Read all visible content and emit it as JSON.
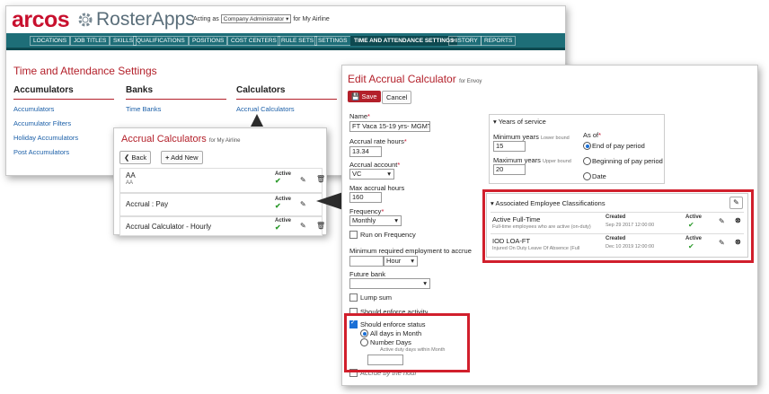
{
  "brand": {
    "logo": "arcos",
    "product": "RosterApps"
  },
  "acting": {
    "prefix": "Acting as",
    "role": "Company Administrator",
    "suffix": "for My Airline"
  },
  "nav": [
    "LOCATIONS",
    "JOB TITLES",
    "SKILLS",
    "QUALIFICATIONS",
    "POSITIONS",
    "COST CENTERS",
    "RULE SETS",
    "SETTINGS",
    "TIME AND ATTENDANCE SETTINGS",
    "HISTORY",
    "REPORTS"
  ],
  "page": {
    "title": "Time and Attendance Settings",
    "columns": {
      "accumulators": {
        "heading": "Accumulators",
        "links": [
          "Accumulators",
          "Accumulator Filters",
          "Holiday Accumulators",
          "Post Accumulators"
        ]
      },
      "banks": {
        "heading": "Banks",
        "links": [
          "Time Banks"
        ]
      },
      "calculators": {
        "heading": "Calculators",
        "links": [
          "Accrual Calculators"
        ]
      }
    }
  },
  "calcs": {
    "title": "Accrual Calculators",
    "subtitle": "for My Airline",
    "back": "Back",
    "add": "Add New",
    "status_label": "Active",
    "rows": [
      {
        "name": "AA",
        "sub": "AA"
      },
      {
        "name": "Accrual : Pay",
        "sub": ""
      },
      {
        "name": "Accrual Calculator - Hourly",
        "sub": ""
      }
    ]
  },
  "edit": {
    "title": "Edit Accrual Calculator",
    "subtitle": "for Envoy",
    "save": "Save",
    "cancel": "Cancel",
    "name_label": "Name",
    "name_value": "FT Vaca 15-19 yrs- MGMT,",
    "rate_label": "Accrual rate hours",
    "rate_value": "13.34",
    "account_label": "Accrual account",
    "account_value": "VC",
    "max_label": "Max accrual hours",
    "max_value": "160",
    "frequency_label": "Frequency",
    "frequency_value": "Monthly",
    "run_on_frequency": "Run on Frequency",
    "min_employment_label": "Minimum required employment to accrue",
    "min_employment_unit": "Hour",
    "future_bank_label": "Future bank",
    "lump_sum": "Lump sum",
    "enforce_activity": "Should enforce activity",
    "enforce_status": "Should enforce status",
    "all_days": "All days in Month",
    "number_days": "Number Days",
    "active_duty_note": "Active duty days within Month",
    "accrue_by_hour": "Accrue by the hour",
    "years": {
      "heading": "Years of service",
      "min_label": "Minimum years",
      "min_note": "Lower bound",
      "min_value": "15",
      "max_label": "Maximum years",
      "max_note": "Upper bound",
      "max_value": "20",
      "as_of_label": "As of",
      "opt_end": "End of pay period",
      "opt_begin": "Beginning of pay period",
      "opt_date": "Date"
    },
    "classifications": {
      "heading": "Associated Employee Classifications",
      "created_label": "Created",
      "active_label": "Active",
      "rows": [
        {
          "name": "Active Full-Time",
          "sub": "Full-time employees who are active (on-duty)",
          "created": "Sep 29 2017 12:00:00"
        },
        {
          "name": "IOD LOA-FT",
          "sub": "Injured On Duty Leave Of Absence (Full",
          "created": "Dec 10 2019 12:00:00"
        }
      ]
    }
  }
}
